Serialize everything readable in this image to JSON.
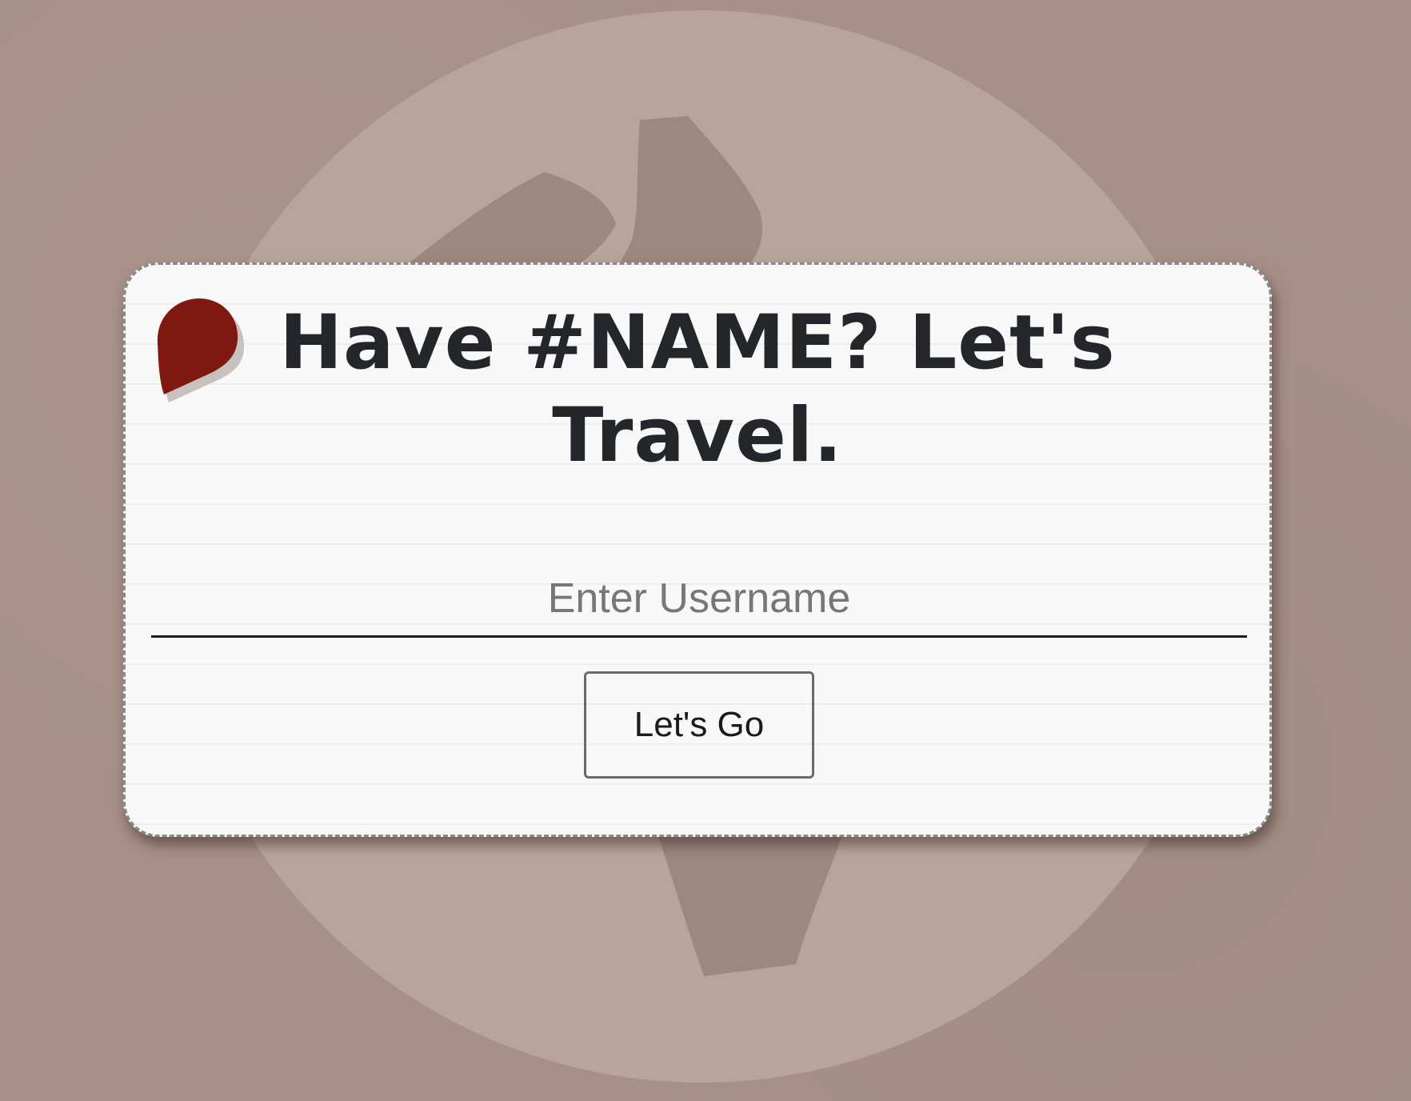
{
  "login": {
    "title": "Have #NAME? Let's Travel.",
    "username_placeholder": "Enter Username",
    "username_value": "",
    "submit_label": "Let's Go"
  },
  "colors": {
    "background": "#a69087",
    "globe": "#b7a49b",
    "continent": "#9d8880",
    "card": "#f8f8f8",
    "pin": "#7f1810",
    "title_text": "#23272c"
  },
  "icons": {
    "background_globe": "globe-icon",
    "card_pin": "map-pin-icon"
  }
}
